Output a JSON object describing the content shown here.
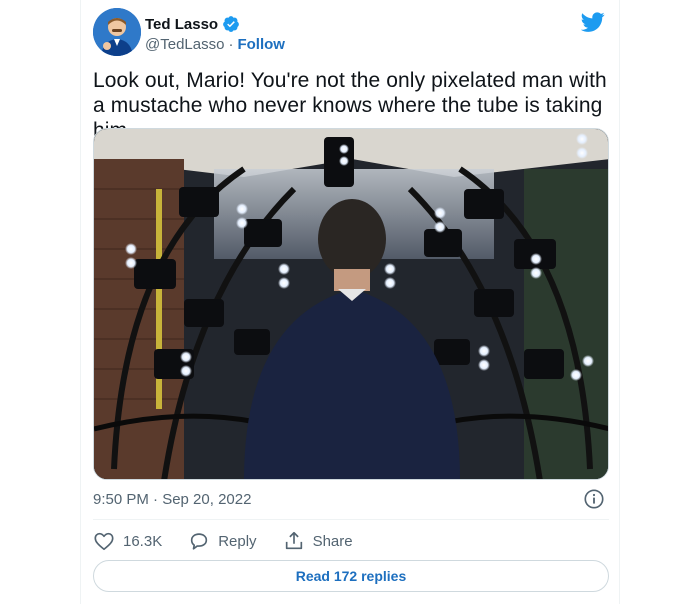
{
  "tweet": {
    "author": {
      "display_name": "Ted Lasso",
      "handle": "@TedLasso",
      "separator": "·",
      "follow_label": "Follow",
      "verified": true,
      "avatar_icon": "avatar-image"
    },
    "platform_icon": "twitter-bird-icon",
    "text": "Look out, Mario! You're not the only pixelated man with a mustache who never knows where the tube is taking him...",
    "media": {
      "type": "photo"
    },
    "timestamp": "9:50 PM · Sep 20, 2022",
    "actions": {
      "likes": "16.3K",
      "reply_label": "Reply",
      "share_label": "Share"
    },
    "read_replies_label": "Read 172 replies"
  },
  "colors": {
    "brand_blue": "#1d9bf0",
    "link_blue": "#1d6fbf",
    "secondary_text": "#536471",
    "border": "#cfd9de"
  }
}
